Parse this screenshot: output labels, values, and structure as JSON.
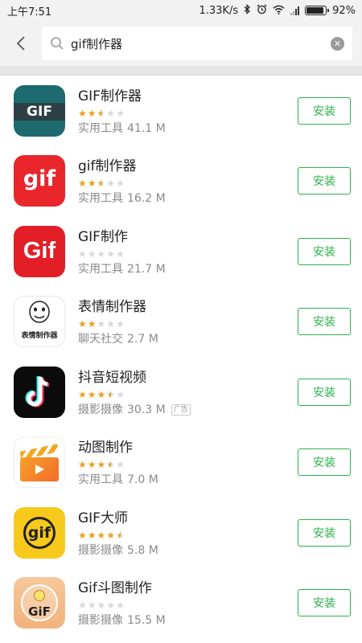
{
  "status": {
    "time": "上午7:51",
    "speed": "1.33K/s",
    "battery": "92%",
    "battery_level": 0.92
  },
  "search": {
    "query": "gif制作器"
  },
  "install_label": "安装",
  "apps": [
    {
      "name": "GIF制作器",
      "category": "实用工具",
      "size": "41.1 M",
      "rating": 2.5,
      "icon": "gif-maker-icon",
      "ad": ""
    },
    {
      "name": "gif制作器",
      "category": "实用工具",
      "size": "16.2 M",
      "rating": 2.5,
      "icon": "gif-red-icon",
      "ad": ""
    },
    {
      "name": "GIF制作",
      "category": "实用工具",
      "size": "21.7 M",
      "rating": 0,
      "icon": "gif-bold-red-icon",
      "ad": ""
    },
    {
      "name": "表情制作器",
      "category": "聊天社交",
      "size": "2.7 M",
      "rating": 2,
      "icon": "emoji-face-icon",
      "icon_text": "表情制作器",
      "ad": ""
    },
    {
      "name": "抖音短视频",
      "category": "摄影摄像",
      "size": "30.3 M",
      "rating": 3.5,
      "icon": "tiktok-note-icon",
      "ad": "广告"
    },
    {
      "name": "动图制作",
      "category": "实用工具",
      "size": "7.0 M",
      "rating": 3.5,
      "icon": "clapper-icon",
      "ad": ""
    },
    {
      "name": "GIF大师",
      "category": "摄影摄像",
      "size": "5.8 M",
      "rating": 4.5,
      "icon": "gif-master-icon",
      "ad": ""
    },
    {
      "name": "Gif斗图制作",
      "category": "摄影摄像",
      "size": "15.5 M",
      "rating": 0,
      "icon": "gif-meme-icon",
      "ad": ""
    }
  ],
  "colors": {
    "accent_green": "#2bb24c",
    "star": "#e8a020"
  }
}
